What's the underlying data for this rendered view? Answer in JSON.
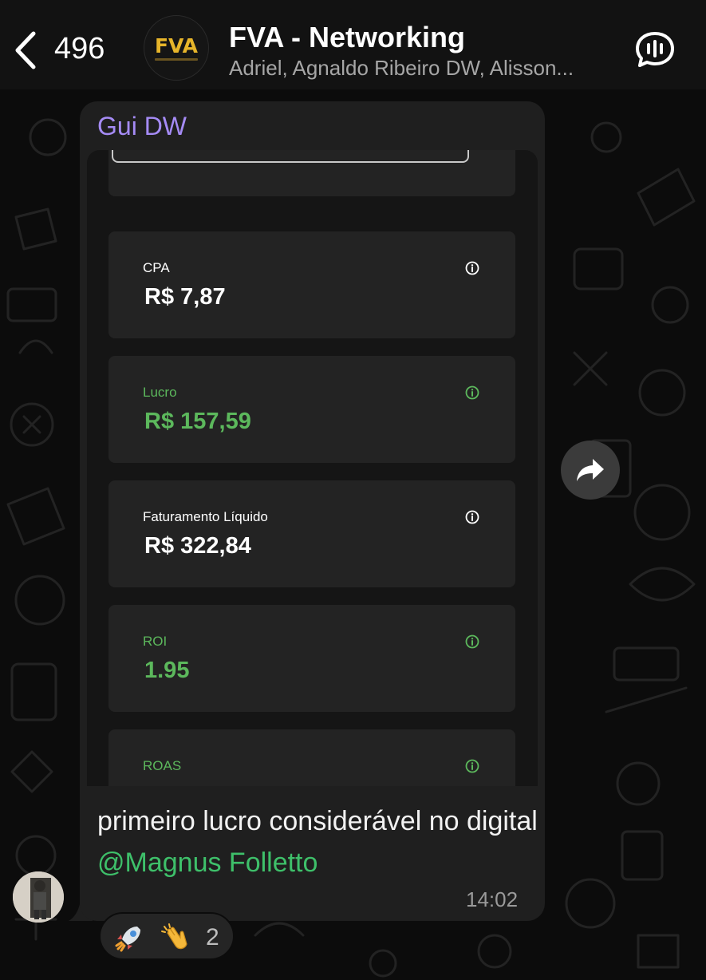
{
  "header": {
    "back_count": "496",
    "group_logo_text": "FVA",
    "group_name": "FVA - Networking",
    "members": "Adriel, Agnaldo Ribeiro DW, Alisson..."
  },
  "message": {
    "sender": "Gui DW",
    "caption_text": "primeiro lucro considerável no digital ",
    "mention": "@Magnus Folletto",
    "time": "14:02"
  },
  "screenshot": {
    "metrics": [
      {
        "label": "CPA",
        "value": "R$ 7,87",
        "color": "#ffffff"
      },
      {
        "label": "Lucro",
        "value": "R$ 157,59",
        "color": "#5cb85c"
      },
      {
        "label": "Faturamento Líquido",
        "value": "R$ 322,84",
        "color": "#ffffff"
      },
      {
        "label": "ROI",
        "value": "1.95",
        "color": "#5cb85c"
      },
      {
        "label": "ROAS",
        "value": "",
        "color": "#5cb85c"
      }
    ]
  },
  "reactions": {
    "items": [
      "rocket",
      "clapping-hands"
    ],
    "count": "2"
  },
  "colors": {
    "sender_name": "#a58bf5",
    "mention": "#3ec06a",
    "profit_green": "#5cb85c",
    "bubble": "#1f1f1f"
  }
}
